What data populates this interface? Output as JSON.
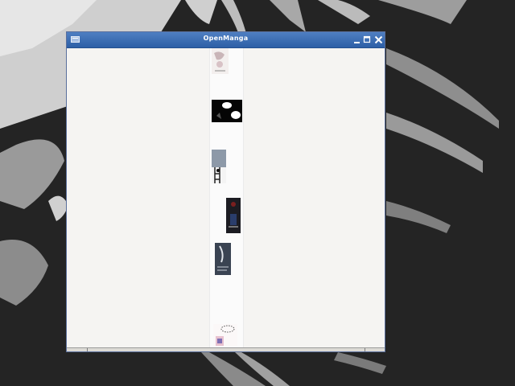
{
  "window": {
    "title": "OpenManga"
  },
  "icons": {
    "menu": "window-menu-icon",
    "minimize": "minimize-icon",
    "maximize": "maximize-icon",
    "close": "close-icon"
  },
  "colors": {
    "titlebar": "#3a6db5",
    "desktop": "#242424",
    "content": "#f5f4f2"
  }
}
